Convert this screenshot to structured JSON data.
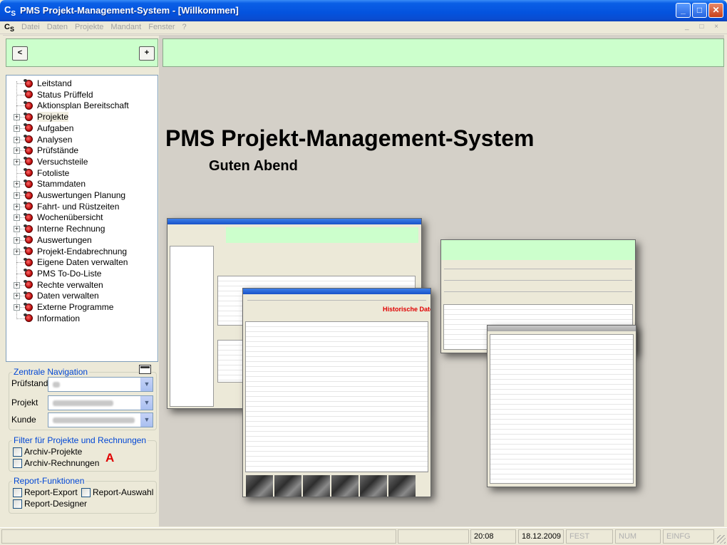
{
  "window": {
    "logo": "C",
    "logo_sub": "S",
    "title": "PMS Projekt-Management-System -  [Willkommen]",
    "minimize": "_",
    "maximize": "□",
    "close": "✕"
  },
  "menu": {
    "items": [
      "Datei",
      "Daten",
      "Projekte",
      "Mandant",
      "Fenster",
      "?"
    ],
    "mdi_controls": "_ □ ×"
  },
  "nav": {
    "back": "<",
    "add": "+"
  },
  "tree": {
    "items": [
      {
        "label": "Leitstand",
        "expandable": false
      },
      {
        "label": "Status Prüffeld",
        "expandable": false
      },
      {
        "label": "Aktionsplan Bereitschaft",
        "expandable": false
      },
      {
        "label": "Projekte",
        "expandable": true,
        "selected": true
      },
      {
        "label": "Aufgaben",
        "expandable": true
      },
      {
        "label": "Analysen",
        "expandable": true
      },
      {
        "label": "Prüfstände",
        "expandable": true
      },
      {
        "label": "Versuchsteile",
        "expandable": true
      },
      {
        "label": "Fotoliste",
        "expandable": false
      },
      {
        "label": "Stammdaten",
        "expandable": true
      },
      {
        "label": "Auswertungen Planung",
        "expandable": true
      },
      {
        "label": "Fahrt- und Rüstzeiten",
        "expandable": true
      },
      {
        "label": "Wochenübersicht",
        "expandable": true
      },
      {
        "label": "Interne Rechnung",
        "expandable": true
      },
      {
        "label": "Auswertungen",
        "expandable": true
      },
      {
        "label": "Projekt-Endabrechnung",
        "expandable": true
      },
      {
        "label": "Eigene Daten verwalten",
        "expandable": false
      },
      {
        "label": "PMS To-Do-Liste",
        "expandable": false
      },
      {
        "label": "Rechte verwalten",
        "expandable": true
      },
      {
        "label": "Daten verwalten",
        "expandable": true
      },
      {
        "label": "Externe Programme",
        "expandable": true
      },
      {
        "label": "Information",
        "expandable": false
      }
    ]
  },
  "zentrale": {
    "title": "Zentrale Navigation",
    "pruefstand_label": "Prüfstand",
    "projekt_label": "Projekt",
    "kunde_label": "Kunde"
  },
  "filter": {
    "title": "Filter für Projekte und Rechnungen",
    "archiv_projekte": "Archiv-Projekte",
    "archiv_rechnungen": "Archiv-Rechnungen"
  },
  "annotation_letter": "A",
  "report": {
    "title": "Report-Funktionen",
    "export": "Report-Export",
    "auswahl": "Report-Auswahl",
    "designer": "Report-Designer"
  },
  "welcome": {
    "headline": "PMS Projekt-Management-System",
    "greeting": "Guten Abend"
  },
  "screenshots": {
    "historische_daten": "Historische Daten"
  },
  "status": {
    "time": "20:08",
    "date": "18.12.2009",
    "fest": "FEST",
    "num": "NUM",
    "einfg": "EINFG"
  },
  "colors": {
    "titlebar": "#0453de",
    "green_panel": "#ccffcc",
    "accent_blue": "#0046d5",
    "annotation_red": "#e00000"
  }
}
